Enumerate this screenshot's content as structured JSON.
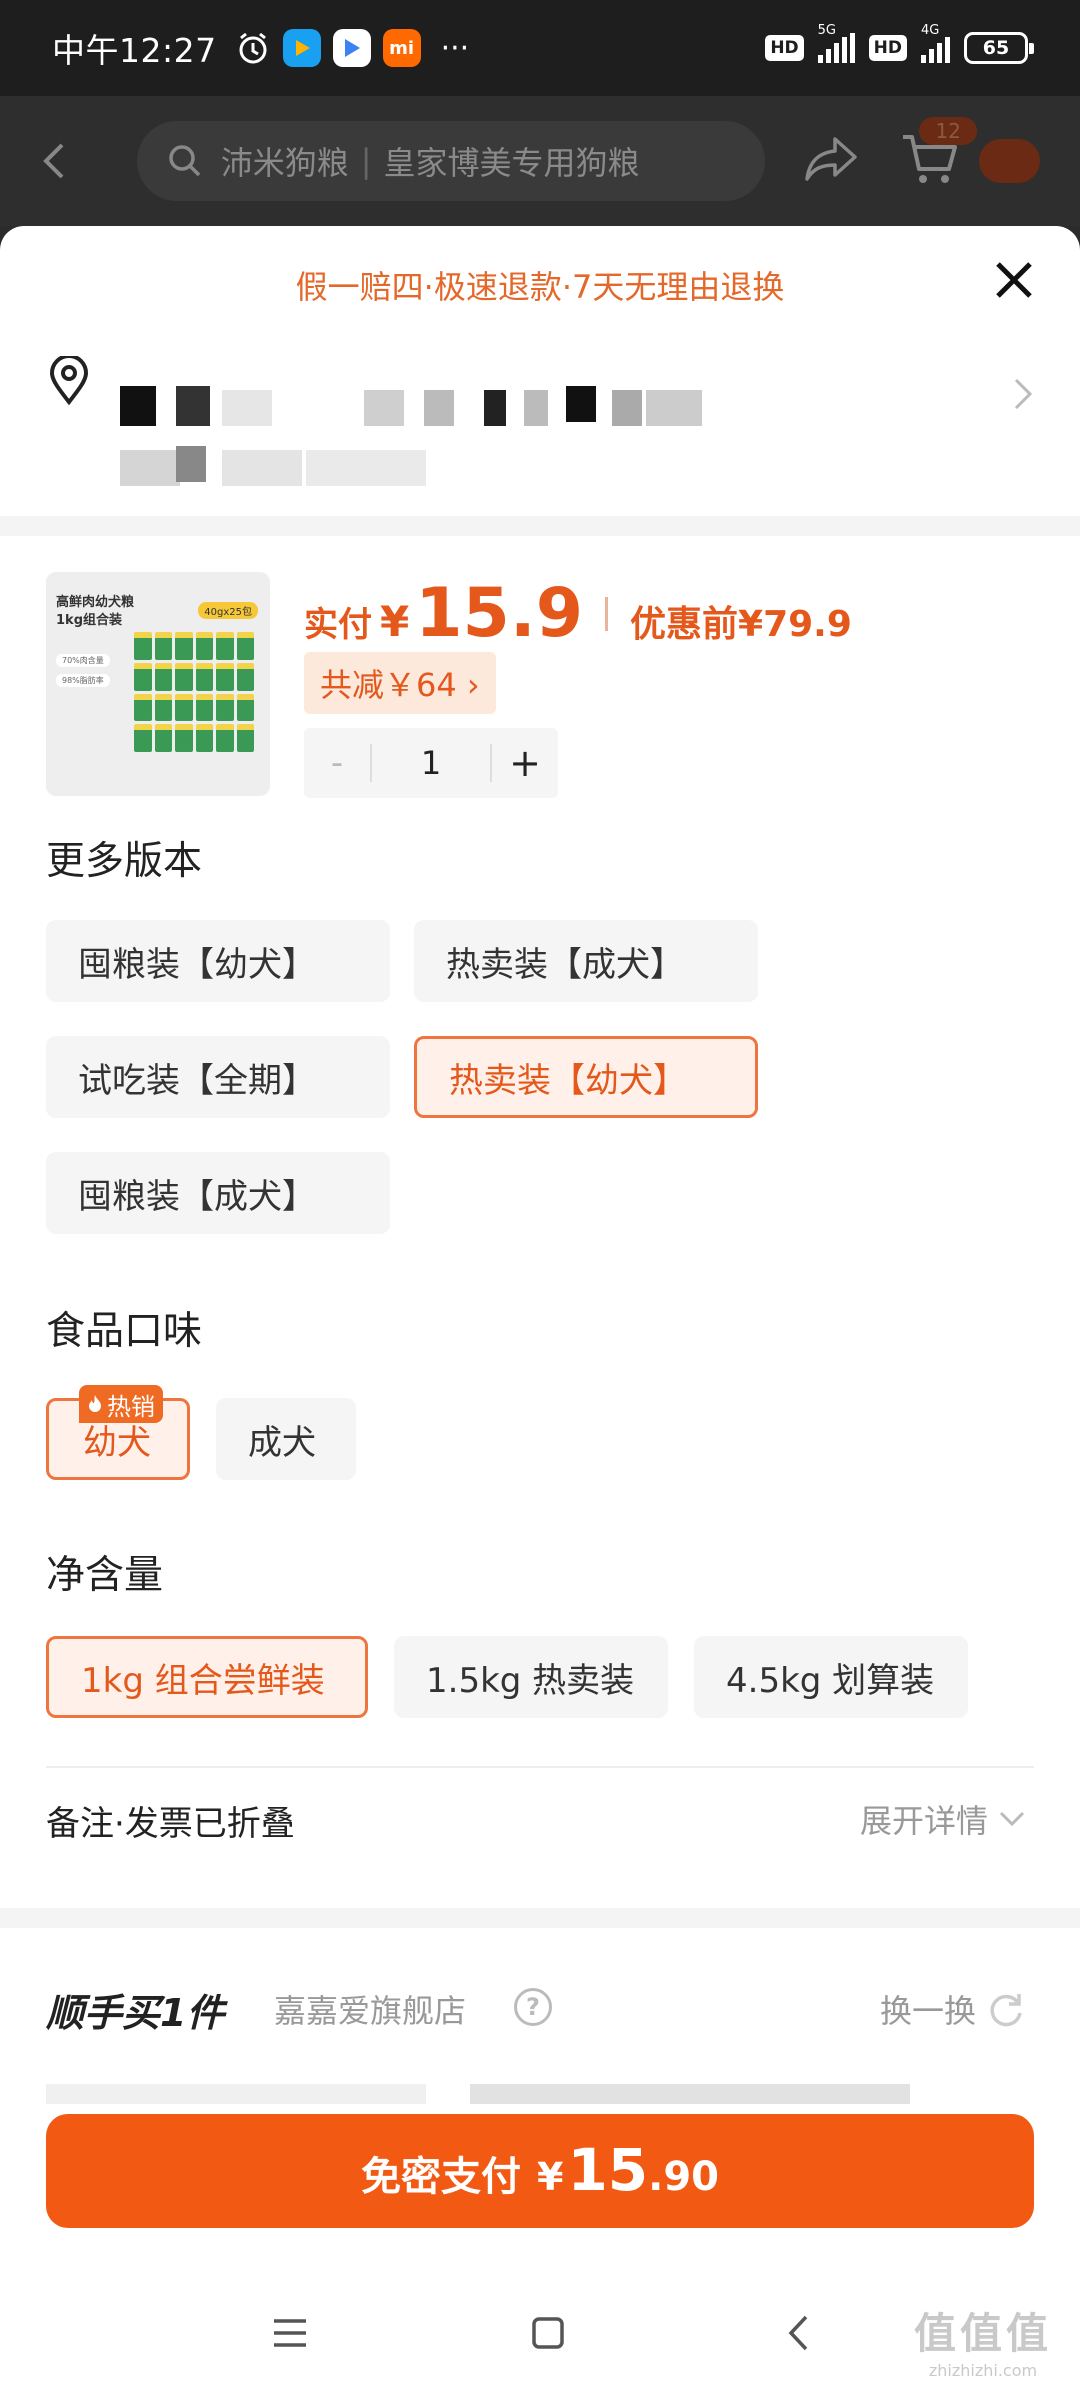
{
  "status_bar": {
    "time": "中午12:27",
    "network_1": "5G",
    "network_2": "4G",
    "hd": "HD",
    "battery": "65"
  },
  "background_nav": {
    "search_text_1": "沛米狗粮",
    "search_text_2": "皇家博美专用狗粮",
    "cart_count": "12"
  },
  "sheet": {
    "guarantee": "假一赔四·极速退款·7天无理由退换",
    "product_image_text": {
      "title": "高鲜肉幼犬粮 1kg组合装",
      "badge": "40gx25包",
      "line1": "70%肉含量",
      "line2": "98%脂肪率"
    },
    "price": {
      "pay_label": "实付",
      "currency": "¥",
      "pay_value": "15.9",
      "before_label": "优惠前",
      "before_value": "¥79.9",
      "discount": "共减￥64 ›"
    },
    "quantity": {
      "minus": "-",
      "value": "1",
      "plus": "+"
    },
    "versions": {
      "title": "更多版本",
      "options": [
        "囤粮装【幼犬】",
        "热卖装【成犬】",
        "试吃装【全期】",
        "热卖装【幼犬】",
        "囤粮装【成犬】"
      ],
      "selected": "热卖装【幼犬】"
    },
    "flavor": {
      "title": "食品口味",
      "hot_badge": "热销",
      "options": [
        "幼犬",
        "成犬"
      ],
      "selected": "幼犬"
    },
    "net_weight": {
      "title": "净含量",
      "options": [
        "1kg 组合尝鲜装",
        "1.5kg 热卖装",
        "4.5kg 划算装"
      ],
      "selected": "1kg 组合尝鲜装"
    },
    "remark": {
      "label": "备注·发票已折叠",
      "expand": "展开详情"
    },
    "addon": {
      "title": "顺手买1件",
      "shop": "嘉嘉爱旗舰店",
      "swap": "换一换"
    },
    "pay_button": {
      "label": "免密支付",
      "currency": "¥",
      "integer": "15",
      "decimal": ".90"
    }
  },
  "watermark": {
    "text": "值值值",
    "url": "zhizhizhi.com"
  },
  "colors": {
    "accent": "#f25a14",
    "accent_text": "#e4581b",
    "selected_bg": "#fff1ea"
  }
}
